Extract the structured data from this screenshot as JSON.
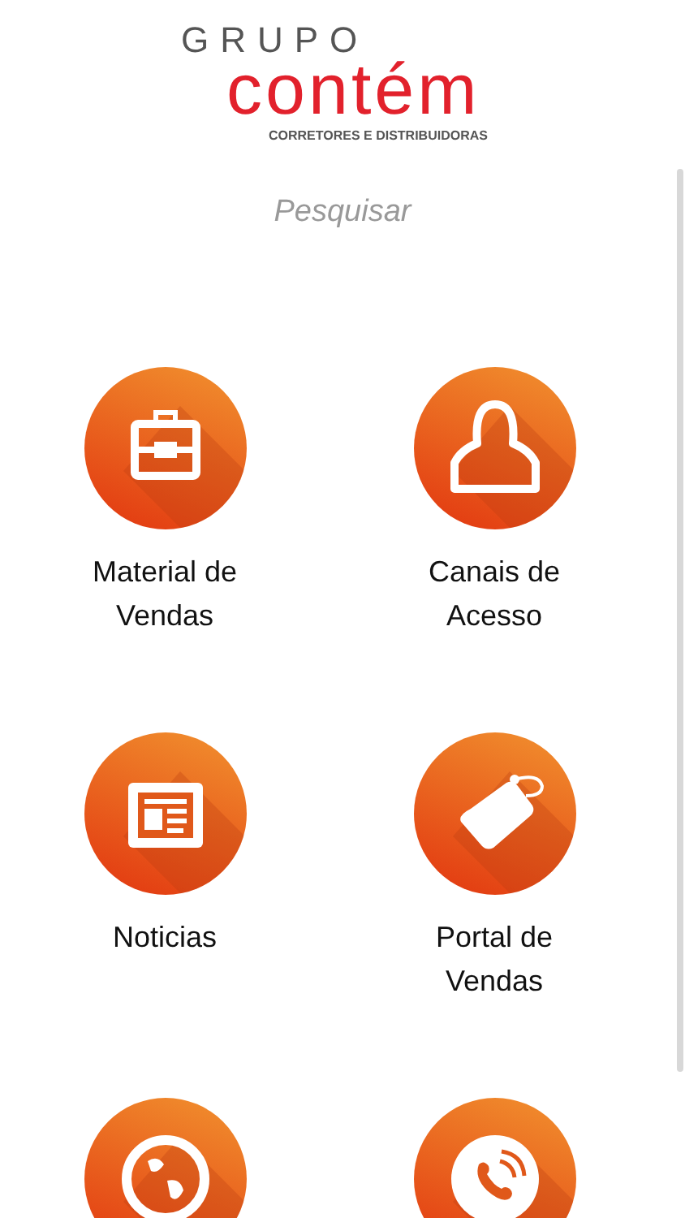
{
  "logo": {
    "top_line": "GRUPO",
    "wordmark": "contém",
    "tagline": "CORRETORES E DISTRIBUIDORAS"
  },
  "search": {
    "placeholder": "Pesquisar"
  },
  "menu": [
    {
      "kind": "briefcase",
      "label": "Material de Vendas"
    },
    {
      "kind": "person",
      "label": "Canais de Acesso"
    },
    {
      "kind": "newspaper",
      "label": "Noticias"
    },
    {
      "kind": "tag",
      "label": "Portal de Vendas"
    },
    {
      "kind": "globe"
    },
    {
      "kind": "phone"
    }
  ]
}
